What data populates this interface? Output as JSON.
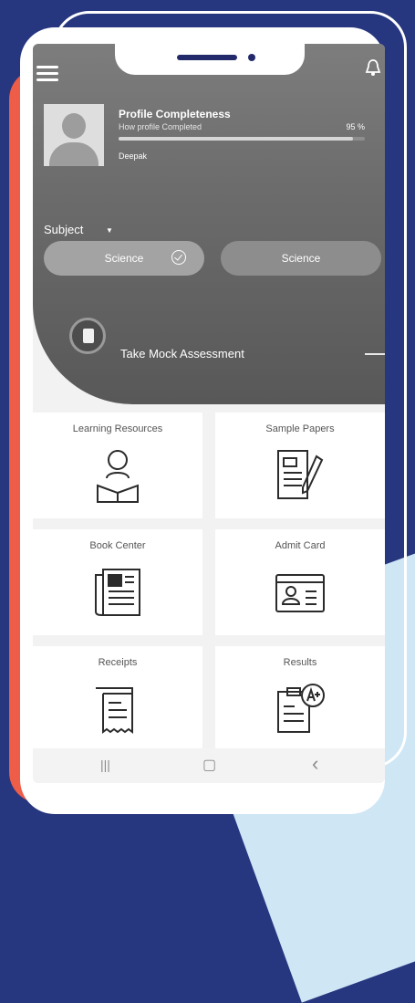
{
  "profile": {
    "title": "Profile Completeness",
    "subtitle": "How profile Completed",
    "percent_text": "95 %",
    "progress": 0.95,
    "name": "Deepak"
  },
  "subject": {
    "label": "Subject",
    "chips": [
      "Science",
      "Science"
    ]
  },
  "mock": {
    "label": "Take Mock Assessment"
  },
  "tiles": [
    {
      "label": "Learning Resources",
      "icon": "reader-icon"
    },
    {
      "label": "Sample Papers",
      "icon": "paper-pen-icon"
    },
    {
      "label": "Book Center",
      "icon": "newspaper-icon"
    },
    {
      "label": "Admit Card",
      "icon": "id-card-icon"
    },
    {
      "label": "Receipts",
      "icon": "receipt-icon"
    },
    {
      "label": "Results",
      "icon": "result-grade-icon"
    }
  ],
  "nav": {
    "recent": "|||",
    "home": "▢",
    "back": "‹"
  },
  "colors": {
    "background": "#26367f",
    "accent": "#ed5d47",
    "hero": "#6c6c6c"
  }
}
